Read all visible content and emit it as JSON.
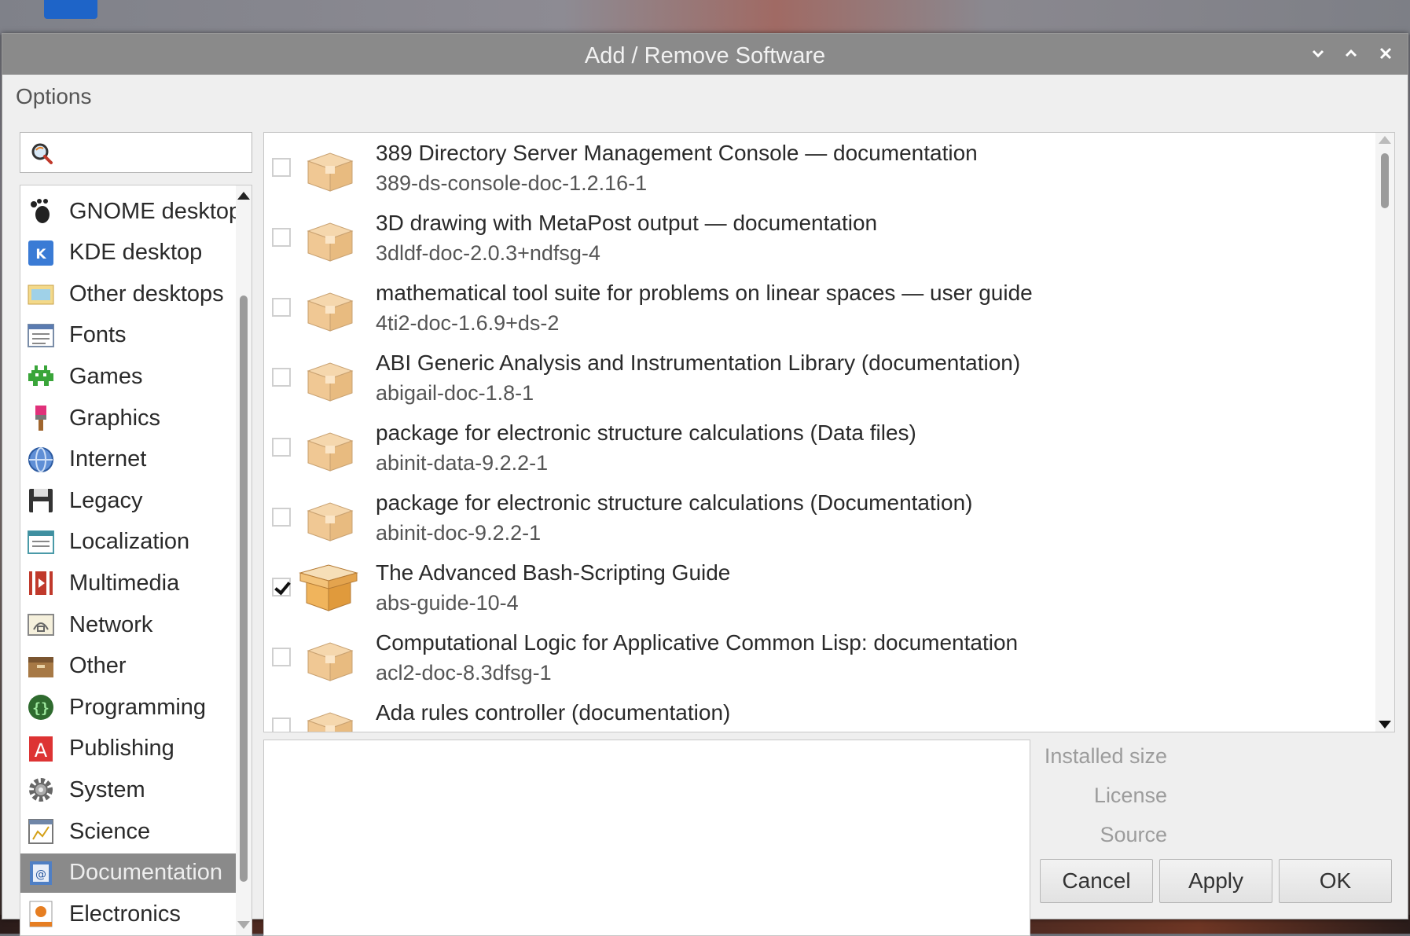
{
  "window": {
    "title": "Add / Remove Software"
  },
  "menubar": {
    "options_label": "Options"
  },
  "search": {
    "value": ""
  },
  "categories": [
    {
      "label": "GNOME desktop",
      "icon": "gnome-foot-icon",
      "selected": false
    },
    {
      "label": "KDE desktop",
      "icon": "kde-icon",
      "selected": false
    },
    {
      "label": "Other desktops",
      "icon": "desktop-icon",
      "selected": false
    },
    {
      "label": "Fonts",
      "icon": "fonts-icon",
      "selected": false
    },
    {
      "label": "Games",
      "icon": "games-icon",
      "selected": false
    },
    {
      "label": "Graphics",
      "icon": "graphics-icon",
      "selected": false
    },
    {
      "label": "Internet",
      "icon": "globe-icon",
      "selected": false
    },
    {
      "label": "Legacy",
      "icon": "floppy-icon",
      "selected": false
    },
    {
      "label": "Localization",
      "icon": "localization-icon",
      "selected": false
    },
    {
      "label": "Multimedia",
      "icon": "multimedia-icon",
      "selected": false
    },
    {
      "label": "Network",
      "icon": "network-icon",
      "selected": false
    },
    {
      "label": "Other",
      "icon": "box-icon",
      "selected": false
    },
    {
      "label": "Programming",
      "icon": "programming-icon",
      "selected": false
    },
    {
      "label": "Publishing",
      "icon": "publishing-icon",
      "selected": false
    },
    {
      "label": "System",
      "icon": "gear-icon",
      "selected": false
    },
    {
      "label": "Science",
      "icon": "science-icon",
      "selected": false
    },
    {
      "label": "Documentation",
      "icon": "documentation-icon",
      "selected": true
    },
    {
      "label": "Electronics",
      "icon": "electronics-icon",
      "selected": false
    }
  ],
  "packages": [
    {
      "name": "389 Directory Server Management Console — documentation",
      "version": "389-ds-console-doc-1.2.16-1",
      "checked": false
    },
    {
      "name": "3D drawing with MetaPost output — documentation",
      "version": "3dldf-doc-2.0.3+ndfsg-4",
      "checked": false
    },
    {
      "name": "mathematical tool suite for problems on linear spaces — user guide",
      "version": "4ti2-doc-1.6.9+ds-2",
      "checked": false
    },
    {
      "name": "ABI Generic Analysis and Instrumentation Library (documentation)",
      "version": "abigail-doc-1.8-1",
      "checked": false
    },
    {
      "name": "package for electronic structure calculations (Data files)",
      "version": "abinit-data-9.2.2-1",
      "checked": false
    },
    {
      "name": "package for electronic structure calculations (Documentation)",
      "version": "abinit-doc-9.2.2-1",
      "checked": false
    },
    {
      "name": "The Advanced Bash-Scripting Guide",
      "version": "abs-guide-10-4",
      "checked": true
    },
    {
      "name": "Computational Logic for Applicative Common Lisp: documentation",
      "version": "acl2-doc-8.3dfsg-1",
      "checked": false
    },
    {
      "name": "Ada rules controller (documentation)",
      "version": "",
      "checked": false
    }
  ],
  "details": {
    "installed_size_label": "Installed size",
    "license_label": "License",
    "source_label": "Source"
  },
  "buttons": {
    "cancel": "Cancel",
    "apply": "Apply",
    "ok": "OK"
  },
  "colors": {
    "titlebar": "#8a8a8a",
    "selection": "#8a8a8a",
    "window_bg": "#efefef"
  }
}
